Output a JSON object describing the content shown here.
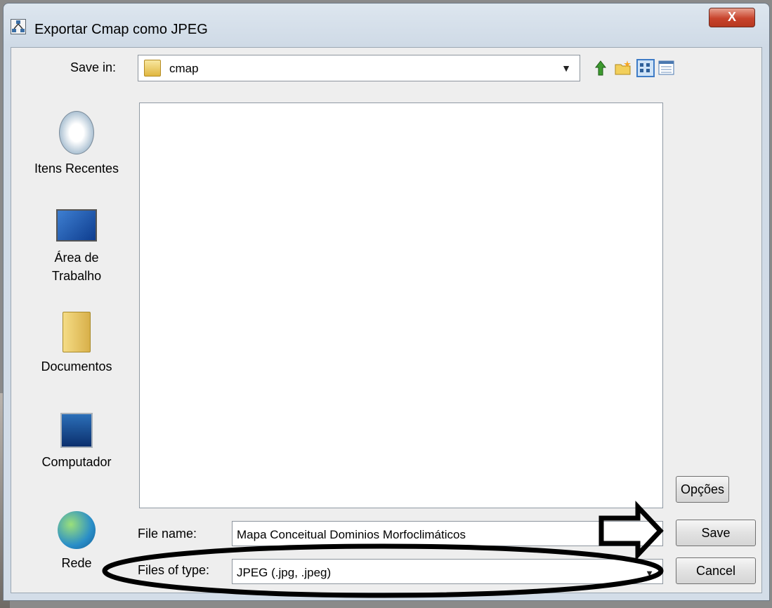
{
  "window": {
    "title": "Exportar Cmap como JPEG",
    "close_label": "X"
  },
  "save_in": {
    "label": "Save in:",
    "value": "cmap"
  },
  "toolbar_icons": [
    "up-folder-icon",
    "new-folder-icon",
    "list-view-icon",
    "details-view-icon"
  ],
  "places": [
    {
      "label": "Itens Recentes",
      "icon": "recent-items-icon"
    },
    {
      "label": "Área de\nTrabalho",
      "icon": "desktop-icon"
    },
    {
      "label": "Documentos",
      "icon": "documents-icon"
    },
    {
      "label": "Computador",
      "icon": "computer-icon"
    },
    {
      "label": "Rede",
      "icon": "network-icon"
    }
  ],
  "file_name": {
    "label": "File name:",
    "value": "Mapa Conceitual Dominios Morfoclimáticos"
  },
  "file_type": {
    "label": "Files of type:",
    "value": "JPEG (.jpg, .jpeg)"
  },
  "buttons": {
    "options": "Opções",
    "save": "Save",
    "cancel": "Cancel"
  },
  "colors": {
    "close_button": "#c8432c",
    "title_bg": "#cfdae6",
    "annotation": "#000000"
  }
}
